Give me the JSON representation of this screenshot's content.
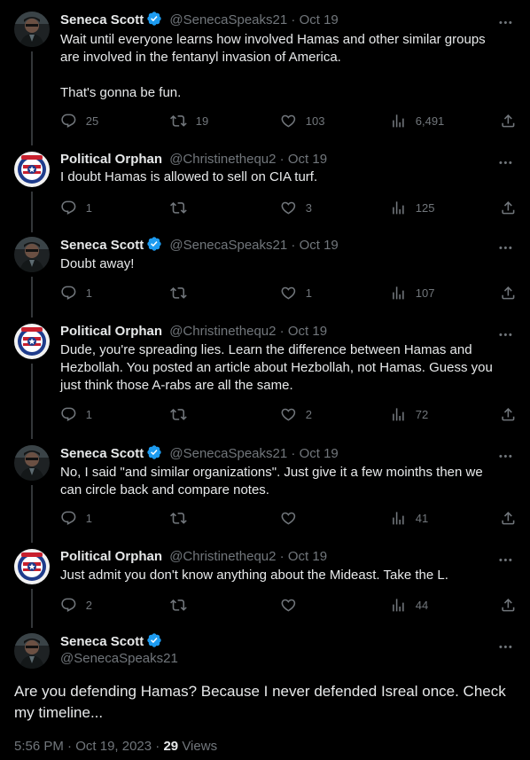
{
  "colors": {
    "background": "#000000",
    "text": "#e7e9ea",
    "muted": "#71767b",
    "verified": "#1d9bf0",
    "thread_line": "#333639"
  },
  "tweets": [
    {
      "name": "Seneca Scott",
      "verified": true,
      "handle": "@SenecaSpeaks21",
      "sep": "·",
      "date": "Oct 19",
      "lines": [
        "Wait until everyone learns how involved Hamas and other similar groups are involved in the fentanyl invasion of America.",
        "That's gonna be fun."
      ],
      "replies": "25",
      "reposts": "19",
      "likes": "103",
      "views": "6,491"
    },
    {
      "name": "Political Orphan",
      "verified": false,
      "handle": "@Christinethequ2",
      "sep": "·",
      "date": "Oct 19",
      "lines": [
        "I doubt Hamas is allowed to sell on CIA turf."
      ],
      "replies": "1",
      "reposts": "",
      "likes": "3",
      "views": "125"
    },
    {
      "name": "Seneca Scott",
      "verified": true,
      "handle": "@SenecaSpeaks21",
      "sep": "·",
      "date": "Oct 19",
      "lines": [
        "Doubt away!"
      ],
      "replies": "1",
      "reposts": "",
      "likes": "1",
      "views": "107"
    },
    {
      "name": "Political Orphan",
      "verified": false,
      "handle": "@Christinethequ2",
      "sep": "·",
      "date": "Oct 19",
      "lines": [
        "Dude, you're spreading lies. Learn the difference between Hamas and Hezbollah. You posted an article about Hezbollah, not Hamas. Guess you just think those A-rabs are all the same."
      ],
      "replies": "1",
      "reposts": "",
      "likes": "2",
      "views": "72"
    },
    {
      "name": "Seneca Scott",
      "verified": true,
      "handle": "@SenecaSpeaks21",
      "sep": "·",
      "date": "Oct 19",
      "lines": [
        "No, I said \"and similar organizations\".  Just give it a few moinths then we can circle back and compare notes."
      ],
      "replies": "1",
      "reposts": "",
      "likes": "",
      "views": "41"
    },
    {
      "name": "Political Orphan",
      "verified": false,
      "handle": "@Christinethequ2",
      "sep": "·",
      "date": "Oct 19",
      "lines": [
        "Just admit you don't know anything about the Mideast. Take the L."
      ],
      "replies": "2",
      "reposts": "",
      "likes": "",
      "views": "44"
    }
  ],
  "main": {
    "name": "Seneca Scott",
    "handle": "@SenecaSpeaks21",
    "text": "Are you defending Hamas? Because I never defended Isreal once. Check my timeline...",
    "time": "5:56 PM",
    "sep": "·",
    "date": "Oct 19, 2023",
    "views_count": "29",
    "views_label": "Views"
  },
  "icons": {
    "reply": "reply-icon",
    "repost": "repost-icon",
    "like": "heart-icon",
    "views": "views-icon",
    "share": "share-icon",
    "more": "more-icon",
    "verified": "verified-badge-icon"
  }
}
